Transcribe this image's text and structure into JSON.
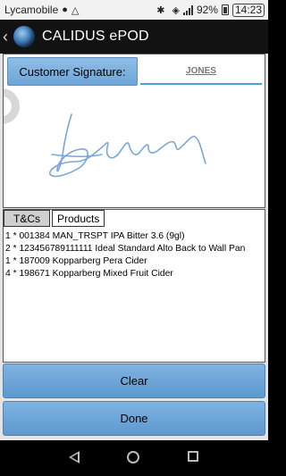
{
  "status_bar": {
    "carrier": "Lycamobile",
    "battery": "92%",
    "time": "14:23",
    "icons": [
      "location-icon",
      "android-icon",
      "bluetooth-icon",
      "wifi-icon",
      "signal-icon",
      "battery-icon"
    ]
  },
  "app_bar": {
    "title": "CALIDUS ePOD",
    "icons": [
      "back-chevron-icon",
      "globe-logo-icon"
    ]
  },
  "signature": {
    "label": "Customer Signature:",
    "name": "JONES",
    "stroke_color": "#7aa6d9"
  },
  "tabs": [
    {
      "label": "T&Cs",
      "active": true
    },
    {
      "label": "Products",
      "active": false
    }
  ],
  "products": [
    "1 * 001384 MAN_TRSPT IPA Bitter 3.6 (9gl)",
    "2 * 123456789111111 Ideal Standard Alto Back to Wall Pan",
    "1 * 187009 Kopparberg Pera Cider",
    "4 * 198671 Kopparberg Mixed Fruit Cider"
  ],
  "buttons": {
    "clear": "Clear",
    "done": "Done"
  },
  "nav_bar": {
    "icons": [
      "nav-back-icon",
      "nav-home-icon",
      "nav-recent-icon"
    ]
  },
  "colors": {
    "button": "#6ea5d7",
    "app_bar": "#121212",
    "underline": "#4f9fce"
  }
}
